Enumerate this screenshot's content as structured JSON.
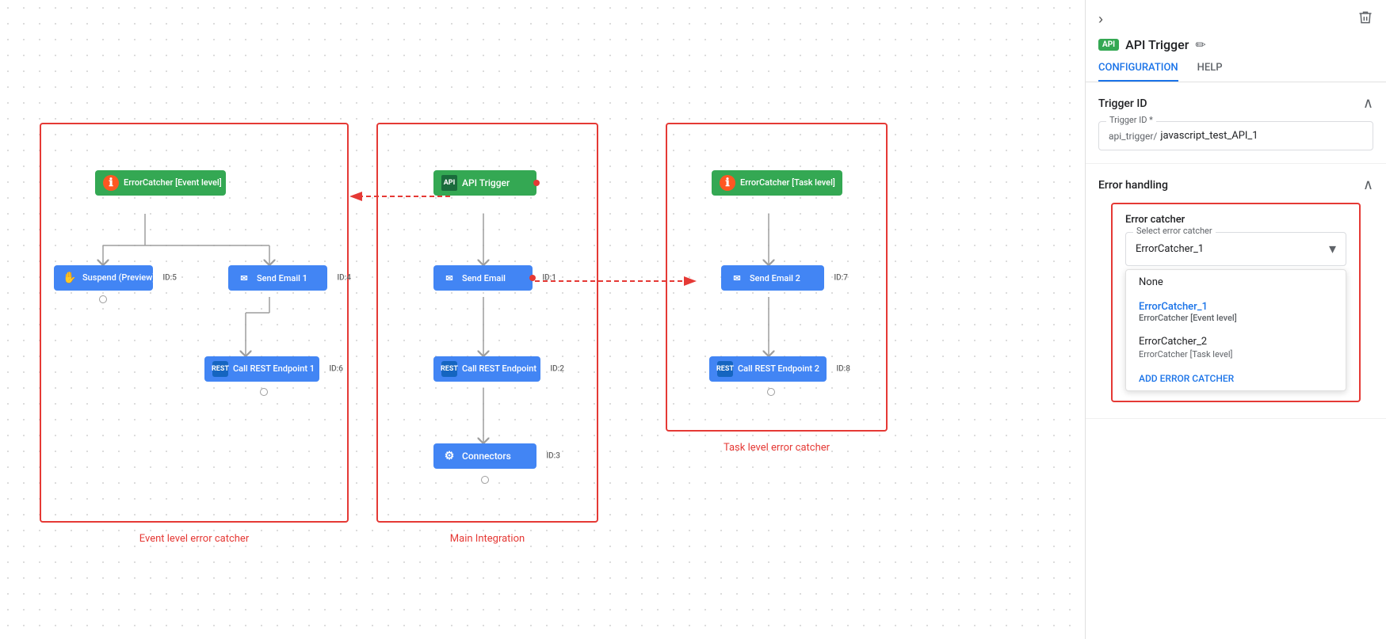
{
  "panel": {
    "collapse_label": "›",
    "delete_label": "🗑",
    "api_badge": "API",
    "title": "API Trigger",
    "edit_icon": "✏",
    "tabs": [
      {
        "id": "configuration",
        "label": "CONFIGURATION",
        "active": true
      },
      {
        "id": "help",
        "label": "HELP",
        "active": false
      }
    ],
    "trigger_id_section": {
      "title": "Trigger ID",
      "field_label": "Trigger ID *",
      "prefix": "api_trigger/",
      "value": "javascript_test_API_1"
    },
    "error_handling_section": {
      "title": "Error handling",
      "error_catcher_title": "Error catcher",
      "select_label": "Select error catcher",
      "selected_value": "ErrorCatcher_1",
      "dropdown_items": [
        {
          "id": "none",
          "label": "None",
          "sub": ""
        },
        {
          "id": "ec1",
          "label": "ErrorCatcher_1",
          "sub": "ErrorCatcher [Event level]"
        },
        {
          "id": "ec2",
          "label": "ErrorCatcher_2",
          "sub": "ErrorCatcher [Task level]"
        }
      ],
      "add_label": "ADD ERROR CATCHER"
    }
  },
  "canvas": {
    "boxes": [
      {
        "id": "event-box",
        "label": "Event level error catcher"
      },
      {
        "id": "main-box",
        "label": "Main Integration"
      },
      {
        "id": "task-box",
        "label": "Task level error catcher"
      }
    ],
    "nodes": {
      "event_catcher": "ErrorCatcher [Event level]",
      "suspend": "Suspend (Preview)",
      "send_email_1": "Send Email 1",
      "call_rest_1": "Call REST Endpoint 1",
      "api_trigger": "API Trigger",
      "send_email": "Send Email",
      "call_rest": "Call REST Endpoint",
      "connectors": "Connectors",
      "task_catcher": "ErrorCatcher [Task level]",
      "send_email_2": "Send Email 2",
      "call_rest_2": "Call REST Endpoint 2"
    },
    "ids": {
      "suspend": "ID:5",
      "send_email_1": "ID:4",
      "call_rest_1": "ID:6",
      "send_email": "ID:1",
      "call_rest": "ID:2",
      "connectors": "ID:3",
      "send_email_2": "ID:7",
      "call_rest_2": "ID:8"
    }
  }
}
